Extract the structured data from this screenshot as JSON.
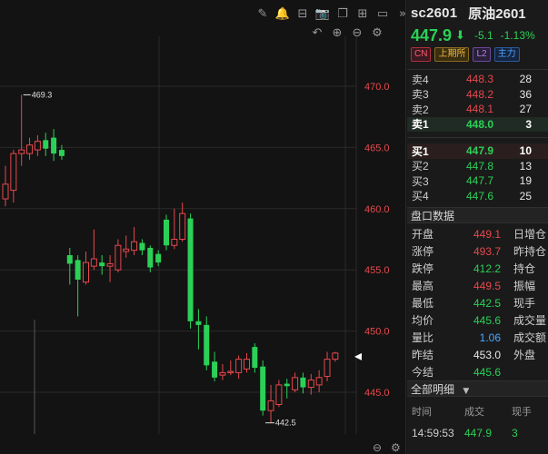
{
  "chart_data": {
    "type": "candlestick",
    "y_ticks": [
      470.0,
      465.0,
      460.0,
      455.0,
      450.0,
      445.0
    ],
    "y_tick_labels": [
      "470.0",
      "465.0",
      "460.0",
      "455.0",
      "450.0",
      "445.0"
    ],
    "high_marker": "469.3",
    "low_marker": "442.5",
    "last_price": 447.9,
    "candles": [
      {
        "o": 460.8,
        "c": 462.0,
        "h": 463.5,
        "l": 460.2
      },
      {
        "o": 461.5,
        "c": 464.5,
        "h": 464.8,
        "l": 460.5
      },
      {
        "o": 464.5,
        "c": 464.8,
        "h": 469.3,
        "l": 463.5
      },
      {
        "o": 464.5,
        "c": 465.2,
        "h": 465.8,
        "l": 464.0
      },
      {
        "o": 464.8,
        "c": 465.5,
        "h": 466.0,
        "l": 464.3
      },
      {
        "o": 465.6,
        "c": 464.9,
        "h": 466.2,
        "l": 464.3
      },
      {
        "o": 465.8,
        "c": 464.5,
        "h": 466.5,
        "l": 463.9
      },
      {
        "o": 464.8,
        "c": 464.3,
        "h": 465.2,
        "l": 464.0
      },
      {
        "o": 456.2,
        "c": 455.5,
        "h": 456.8,
        "l": 453.8
      },
      {
        "o": 455.8,
        "c": 454.2,
        "h": 456.2,
        "l": 451.2
      },
      {
        "o": 454.0,
        "c": 455.6,
        "h": 456.5,
        "l": 453.8
      },
      {
        "o": 455.3,
        "c": 455.9,
        "h": 458.3,
        "l": 455.0
      },
      {
        "o": 455.6,
        "c": 455.3,
        "h": 456.2,
        "l": 454.6
      },
      {
        "o": 455.3,
        "c": 455.5,
        "h": 456.2,
        "l": 454.0
      },
      {
        "o": 455.0,
        "c": 457.0,
        "h": 457.5,
        "l": 454.8
      },
      {
        "o": 456.5,
        "c": 456.7,
        "h": 457.8,
        "l": 456.0
      },
      {
        "o": 456.6,
        "c": 457.3,
        "h": 458.5,
        "l": 456.2
      },
      {
        "o": 457.2,
        "c": 456.6,
        "h": 457.5,
        "l": 456.2
      },
      {
        "o": 456.8,
        "c": 455.2,
        "h": 457.0,
        "l": 454.8
      },
      {
        "o": 456.3,
        "c": 455.6,
        "h": 456.6,
        "l": 455.3
      },
      {
        "o": 459.1,
        "c": 457.0,
        "h": 459.5,
        "l": 456.6
      },
      {
        "o": 457.0,
        "c": 457.5,
        "h": 460.0,
        "l": 456.7
      },
      {
        "o": 457.5,
        "c": 459.6,
        "h": 460.5,
        "l": 457.3
      },
      {
        "o": 459.2,
        "c": 450.8,
        "h": 459.6,
        "l": 450.2
      },
      {
        "o": 450.8,
        "c": 450.5,
        "h": 451.8,
        "l": 448.5
      },
      {
        "o": 450.5,
        "c": 447.2,
        "h": 451.2,
        "l": 446.8
      },
      {
        "o": 447.5,
        "c": 446.2,
        "h": 448.3,
        "l": 445.9
      },
      {
        "o": 446.4,
        "c": 446.6,
        "h": 447.3,
        "l": 446.0
      },
      {
        "o": 446.6,
        "c": 446.7,
        "h": 447.6,
        "l": 446.4
      },
      {
        "o": 446.6,
        "c": 447.7,
        "h": 448.0,
        "l": 446.1
      },
      {
        "o": 446.9,
        "c": 447.7,
        "h": 448.2,
        "l": 446.6
      },
      {
        "o": 448.7,
        "c": 447.0,
        "h": 449.0,
        "l": 446.6
      },
      {
        "o": 447.1,
        "c": 443.5,
        "h": 447.6,
        "l": 443.1
      },
      {
        "o": 443.5,
        "c": 444.3,
        "h": 445.6,
        "l": 442.5
      },
      {
        "o": 444.0,
        "c": 445.6,
        "h": 446.0,
        "l": 443.8
      },
      {
        "o": 445.7,
        "c": 445.5,
        "h": 446.1,
        "l": 444.5
      },
      {
        "o": 445.2,
        "c": 446.2,
        "h": 446.6,
        "l": 445.0
      },
      {
        "o": 446.2,
        "c": 445.4,
        "h": 446.6,
        "l": 444.9
      },
      {
        "o": 445.4,
        "c": 446.0,
        "h": 446.5,
        "l": 444.8
      },
      {
        "o": 445.6,
        "c": 446.2,
        "h": 446.8,
        "l": 445.0
      },
      {
        "o": 446.3,
        "c": 447.7,
        "h": 448.3,
        "l": 445.9
      },
      {
        "o": 447.7,
        "c": 448.2,
        "h": 448.3,
        "l": 447.5
      }
    ]
  },
  "toolbar": {
    "top_icons": [
      "pencil-icon",
      "bell-icon",
      "compare-icon",
      "camera-icon",
      "copy-icon",
      "grid-icon",
      "window-icon",
      "expand-icon"
    ],
    "top_glyphs": [
      "✎",
      "🔔",
      "⊟",
      "📷",
      "❐",
      "⊞",
      "▭",
      "»"
    ],
    "sub_icons": [
      "undo-icon",
      "zoom-in-icon",
      "zoom-out-icon",
      "settings-icon"
    ],
    "sub_glyphs": [
      "↶",
      "⊕",
      "⊖",
      "⚙"
    ]
  },
  "header": {
    "code": "sc2601",
    "name": "原油2601",
    "price": "447.9",
    "arrow": "⬇",
    "change": "-5.1",
    "change_pct": "-1.13%",
    "tags": [
      "CN",
      "上期所",
      "L2",
      "主力"
    ]
  },
  "orderbook": {
    "asks": [
      {
        "label": "卖4",
        "price": "448.3",
        "vol": "28"
      },
      {
        "label": "卖3",
        "price": "448.2",
        "vol": "36"
      },
      {
        "label": "卖2",
        "price": "448.1",
        "vol": "27"
      },
      {
        "label": "卖1",
        "price": "448.0",
        "vol": "3"
      }
    ],
    "bids": [
      {
        "label": "买1",
        "price": "447.9",
        "vol": "10"
      },
      {
        "label": "买2",
        "price": "447.8",
        "vol": "13"
      },
      {
        "label": "买3",
        "price": "447.7",
        "vol": "19"
      },
      {
        "label": "买4",
        "price": "447.6",
        "vol": "25"
      }
    ]
  },
  "quote": {
    "title": "盘口数据",
    "rows": [
      {
        "label": "开盘",
        "value": "449.1",
        "right": "日增仓"
      },
      {
        "label": "涨停",
        "value": "493.7",
        "right": "昨持仓"
      },
      {
        "label": "跌停",
        "value": "412.2",
        "right": "持仓"
      },
      {
        "label": "最高",
        "value": "449.5",
        "right": "振幅"
      },
      {
        "label": "最低",
        "value": "442.5",
        "right": "现手"
      },
      {
        "label": "均价",
        "value": "445.6",
        "right": "成交量"
      },
      {
        "label": "量比",
        "value": "1.06",
        "right": "成交额"
      },
      {
        "label": "昨结",
        "value": "453.0",
        "right": "外盘"
      },
      {
        "label": "今结",
        "value": "445.6",
        "right": ""
      }
    ]
  },
  "trades": {
    "title": "全部明细",
    "dropdown_arrow": "▼",
    "headers": [
      "时间",
      "成交",
      "现手"
    ],
    "rows": [
      {
        "time": "14:59:53",
        "price": "447.9",
        "vol": "3"
      }
    ]
  }
}
